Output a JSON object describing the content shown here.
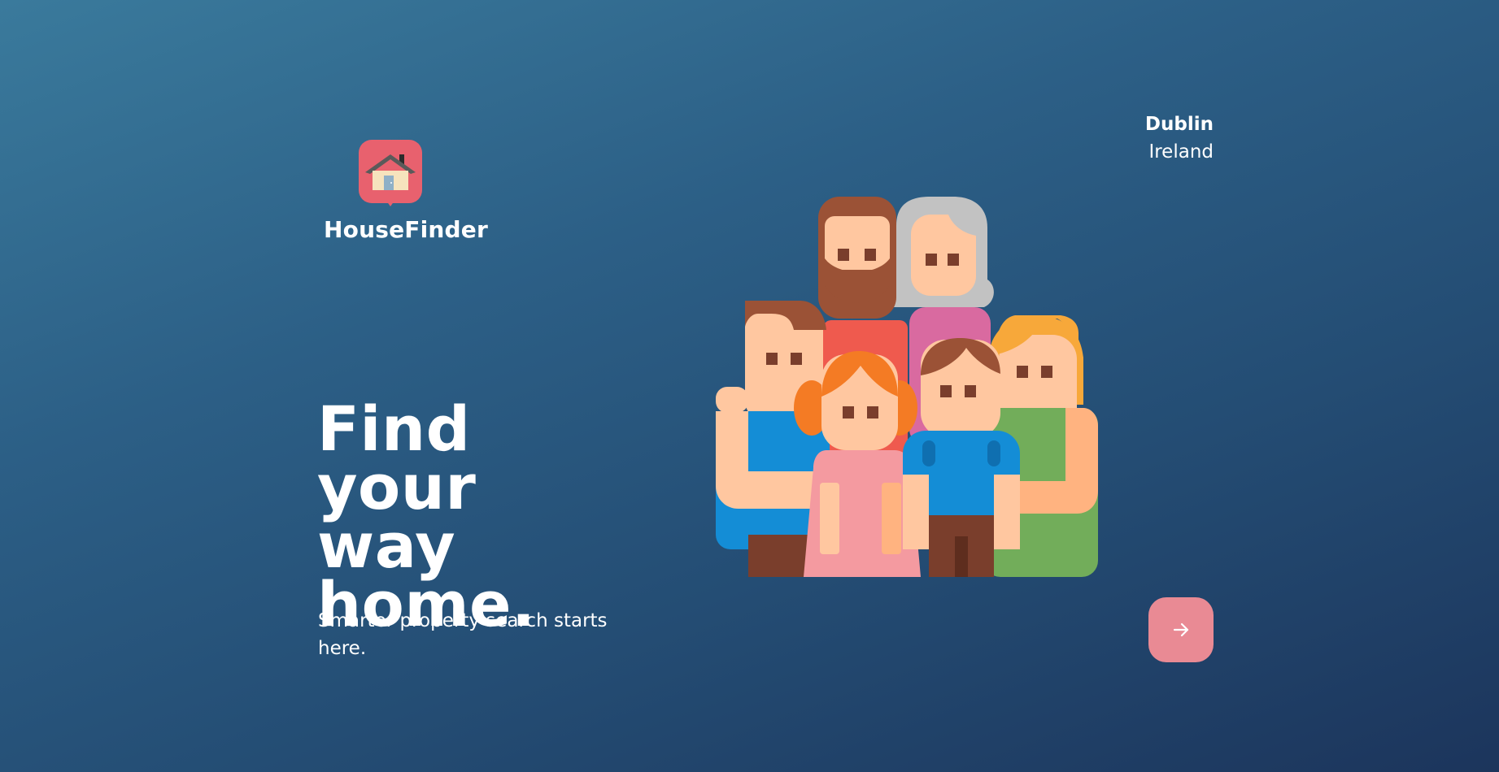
{
  "brand": {
    "name": "HouseFinder",
    "logo_icon": "house-pin-icon",
    "logo_color": "#e8616e"
  },
  "location": {
    "city": "Dublin",
    "country": "Ireland"
  },
  "hero": {
    "title_line1": "Find your",
    "title_line2": "way",
    "title_line3": "home.",
    "subtitle": "Smarter property search starts here."
  },
  "illustration": {
    "icon": "family-illustration"
  },
  "cta": {
    "icon": "arrow-right-icon",
    "color": "#e98a94"
  },
  "theme": {
    "background_start": "#3a7a9c",
    "background_end": "#1c355c"
  }
}
